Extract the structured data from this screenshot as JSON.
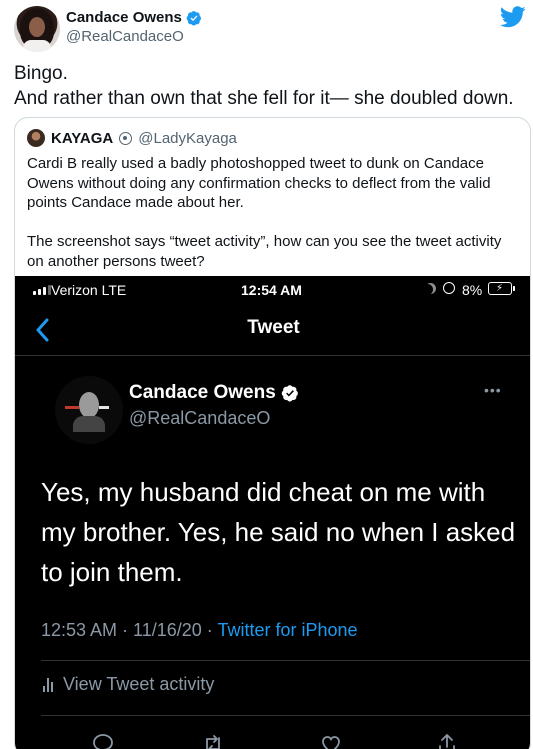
{
  "tweet": {
    "author_name": "Candace Owens",
    "author_handle": "@RealCandaceO",
    "body_lines": [
      "Bingo.",
      "And rather than own that she fell for it— she doubled down."
    ],
    "brand_color": "#1d9bf0"
  },
  "quote": {
    "author_name": "KAYAGA",
    "author_handle": "@LadyKayaga",
    "paragraph_1": "Cardi B really used a badly photoshopped tweet to dunk on Candace Owens without doing any confirmation checks to deflect from the valid points Candace made about her.",
    "paragraph_2": "The screenshot says “tweet activity”, how can you see the tweet activity on another persons tweet?"
  },
  "screenshot": {
    "status_bar": {
      "carrier": "Verizon  LTE",
      "time": "12:54 AM",
      "battery_percent": "8%"
    },
    "nav": {
      "title": "Tweet"
    },
    "inner_tweet": {
      "author_name": "Candace Owens",
      "author_handle": "@RealCandaceO",
      "more_label": "•••",
      "text": "Yes, my husband did cheat on me with my brother. Yes, he said no when I asked to join them.",
      "timestamp": "12:53 AM · 11/16/20 · ",
      "source": "Twitter for iPhone",
      "activity_label": "View Tweet activity"
    }
  },
  "icons": [
    "verified-badge-icon",
    "twitter-bird-icon",
    "back-chevron-icon",
    "reply-icon",
    "retweet-icon",
    "like-icon",
    "share-icon"
  ]
}
